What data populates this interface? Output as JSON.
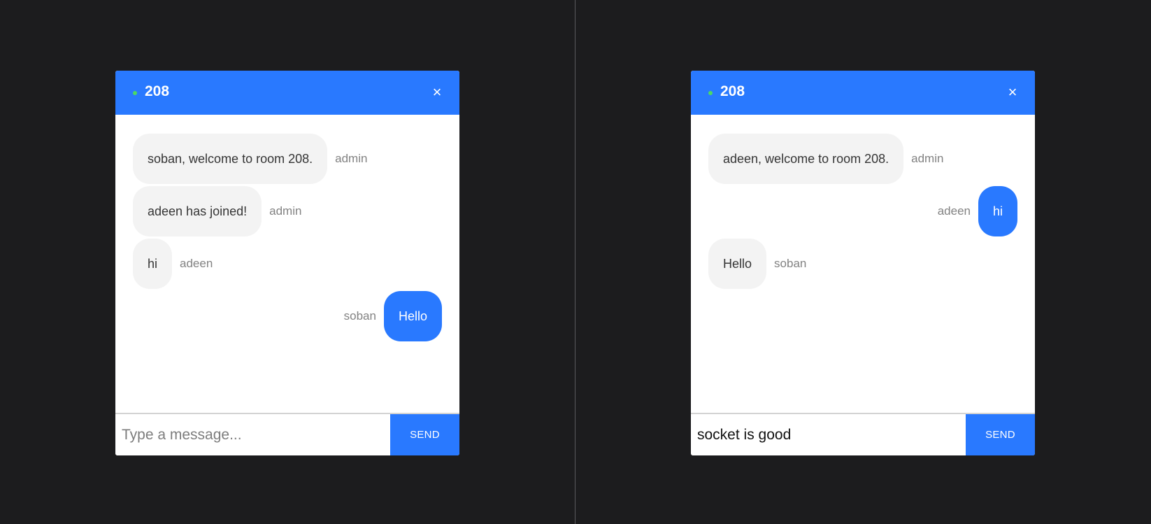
{
  "panes": [
    {
      "room": "208",
      "close_icon": "×",
      "messages": [
        {
          "side": "them",
          "text": "soban, welcome to room 208.",
          "sender": "admin"
        },
        {
          "side": "them",
          "text": "adeen has joined!",
          "sender": "admin"
        },
        {
          "side": "them",
          "text": "hi",
          "sender": "adeen"
        },
        {
          "side": "me",
          "text": "Hello",
          "sender": "soban"
        }
      ],
      "input": {
        "value": "",
        "placeholder": "Type a message..."
      },
      "send_label": "SEND"
    },
    {
      "room": "208",
      "close_icon": "×",
      "messages": [
        {
          "side": "them",
          "text": "adeen, welcome to room 208.",
          "sender": "admin"
        },
        {
          "side": "me",
          "text": "hi",
          "sender": "adeen"
        },
        {
          "side": "them",
          "text": "Hello",
          "sender": "soban"
        }
      ],
      "input": {
        "value": "socket is good",
        "placeholder": "Type a message..."
      },
      "send_label": "SEND"
    }
  ],
  "colors": {
    "background": "#1c1c1e",
    "accent": "#2979ff",
    "online": "#4cd964",
    "bubble_them": "#f3f3f3"
  }
}
